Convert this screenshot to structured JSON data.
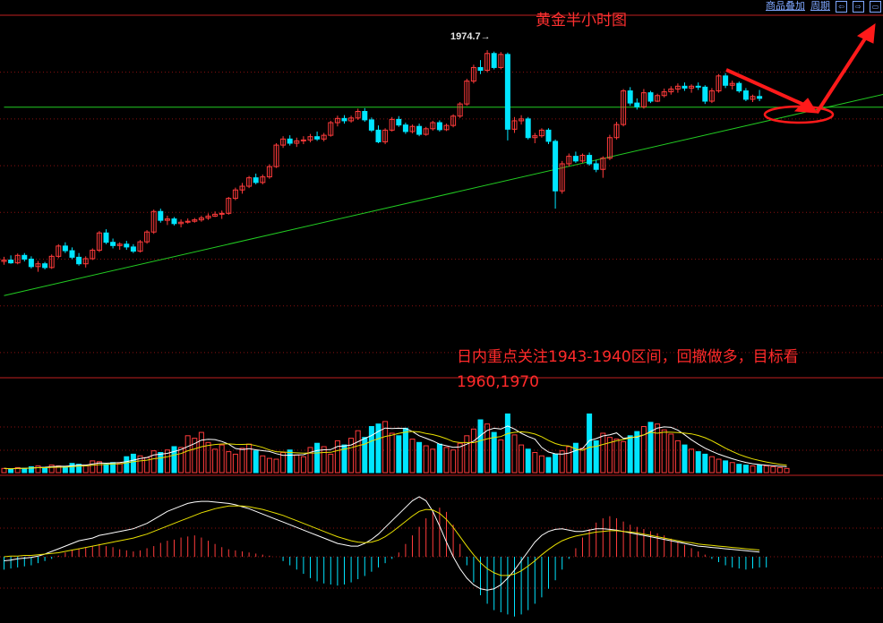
{
  "toolbar": {
    "overlay_label": "商品叠加",
    "period_label": "周期",
    "icons": [
      "arrow-left-icon",
      "arrow-right-icon",
      "layout-icon"
    ]
  },
  "chart_title": "黄金半小时图",
  "annotation": {
    "line1": "日内重点关注1943-1940区间，回撤做多，目标看",
    "line2": "1960,1970"
  },
  "high_label": "1974.7→",
  "colors": {
    "background": "#000000",
    "up": "#ff3b3b",
    "down": "#00e5ff",
    "grid": "#8a1010",
    "trendline": "#22cc22",
    "ma_white": "#ffffff",
    "ma_yellow": "#e8e000",
    "annotation": "#ff2020"
  },
  "chart_data": [
    {
      "type": "candlestick",
      "title": "黄金半小时图",
      "ylim": [
        1905,
        1982
      ],
      "max_label": 1974.7,
      "ohlc": [
        [
          1929.5,
          1930.5,
          1928.8,
          1929.8
        ],
        [
          1929.8,
          1930.8,
          1929.0,
          1929.2
        ],
        [
          1929.2,
          1931.2,
          1928.9,
          1930.8
        ],
        [
          1930.8,
          1931.3,
          1929.5,
          1930.0
        ],
        [
          1930.0,
          1930.6,
          1928.0,
          1928.4
        ],
        [
          1928.4,
          1929.6,
          1927.3,
          1929.0
        ],
        [
          1929.0,
          1929.4,
          1927.8,
          1928.2
        ],
        [
          1928.2,
          1931.0,
          1927.9,
          1930.6
        ],
        [
          1930.6,
          1933.2,
          1930.2,
          1932.8
        ],
        [
          1932.8,
          1933.6,
          1931.3,
          1931.8
        ],
        [
          1931.8,
          1932.5,
          1930.0,
          1930.4
        ],
        [
          1930.4,
          1931.3,
          1928.6,
          1929.0
        ],
        [
          1929.0,
          1930.6,
          1928.2,
          1930.1
        ],
        [
          1930.1,
          1932.3,
          1929.8,
          1931.9
        ],
        [
          1931.9,
          1936.0,
          1931.5,
          1935.6
        ],
        [
          1935.6,
          1936.4,
          1933.2,
          1933.6
        ],
        [
          1933.6,
          1934.4,
          1932.3,
          1932.9
        ],
        [
          1932.9,
          1933.6,
          1932.0,
          1933.2
        ],
        [
          1933.2,
          1933.9,
          1932.0,
          1932.6
        ],
        [
          1932.6,
          1933.2,
          1931.3,
          1931.7
        ],
        [
          1931.7,
          1934.1,
          1931.4,
          1933.7
        ],
        [
          1933.7,
          1936.2,
          1933.3,
          1935.8
        ],
        [
          1935.8,
          1940.6,
          1935.4,
          1940.2
        ],
        [
          1940.2,
          1940.8,
          1937.8,
          1938.3
        ],
        [
          1938.3,
          1939.3,
          1937.3,
          1938.6
        ],
        [
          1938.6,
          1939.0,
          1937.2,
          1937.6
        ],
        [
          1937.6,
          1938.5,
          1936.8,
          1937.9
        ],
        [
          1937.9,
          1938.7,
          1937.6,
          1938.1
        ],
        [
          1938.1,
          1938.8,
          1937.8,
          1938.4
        ],
        [
          1938.4,
          1939.3,
          1938.0,
          1938.8
        ],
        [
          1938.8,
          1939.8,
          1938.4,
          1939.2
        ],
        [
          1939.2,
          1940.2,
          1939.0,
          1939.6
        ],
        [
          1939.6,
          1940.4,
          1938.6,
          1939.8
        ],
        [
          1939.8,
          1943.3,
          1939.5,
          1943.0
        ],
        [
          1943.0,
          1945.3,
          1942.6,
          1944.8
        ],
        [
          1944.8,
          1946.3,
          1944.0,
          1945.6
        ],
        [
          1945.6,
          1947.8,
          1945.2,
          1947.4
        ],
        [
          1947.4,
          1948.3,
          1946.0,
          1946.4
        ],
        [
          1946.4,
          1948.1,
          1946.0,
          1947.6
        ],
        [
          1947.6,
          1950.3,
          1947.2,
          1949.8
        ],
        [
          1949.8,
          1954.8,
          1949.5,
          1954.4
        ],
        [
          1954.4,
          1956.3,
          1953.8,
          1955.7
        ],
        [
          1955.7,
          1956.5,
          1954.3,
          1954.8
        ],
        [
          1954.8,
          1956.0,
          1954.0,
          1955.3
        ],
        [
          1955.3,
          1956.3,
          1954.6,
          1955.5
        ],
        [
          1955.5,
          1956.8,
          1955.0,
          1956.2
        ],
        [
          1956.2,
          1957.3,
          1955.3,
          1955.7
        ],
        [
          1955.7,
          1957.0,
          1955.2,
          1956.5
        ],
        [
          1956.5,
          1959.6,
          1956.2,
          1959.2
        ],
        [
          1959.2,
          1960.7,
          1958.4,
          1960.1
        ],
        [
          1960.1,
          1960.8,
          1959.0,
          1959.6
        ],
        [
          1959.6,
          1960.7,
          1959.2,
          1960.2
        ],
        [
          1960.2,
          1962.2,
          1959.8,
          1961.6
        ],
        [
          1961.6,
          1962.3,
          1959.4,
          1959.8
        ],
        [
          1959.8,
          1960.3,
          1957.2,
          1957.6
        ],
        [
          1957.6,
          1958.6,
          1954.8,
          1955.1
        ],
        [
          1955.1,
          1958.0,
          1954.6,
          1957.6
        ],
        [
          1957.6,
          1960.4,
          1957.3,
          1959.9
        ],
        [
          1959.9,
          1960.6,
          1958.3,
          1958.7
        ],
        [
          1958.7,
          1959.2,
          1956.8,
          1957.3
        ],
        [
          1957.3,
          1958.8,
          1956.9,
          1958.4
        ],
        [
          1958.4,
          1959.0,
          1956.3,
          1956.7
        ],
        [
          1956.7,
          1958.3,
          1956.4,
          1957.9
        ],
        [
          1957.9,
          1959.6,
          1957.5,
          1959.2
        ],
        [
          1959.2,
          1959.7,
          1957.3,
          1957.7
        ],
        [
          1957.7,
          1959.0,
          1957.4,
          1958.6
        ],
        [
          1958.6,
          1961.0,
          1958.2,
          1960.6
        ],
        [
          1960.6,
          1963.6,
          1960.2,
          1963.2
        ],
        [
          1963.2,
          1968.6,
          1962.8,
          1968.1
        ],
        [
          1968.1,
          1971.6,
          1967.6,
          1971.0
        ],
        [
          1971.0,
          1972.6,
          1969.6,
          1970.4
        ],
        [
          1970.4,
          1974.7,
          1970.0,
          1974.0
        ],
        [
          1974.0,
          1974.4,
          1970.6,
          1971.0
        ],
        [
          1971.0,
          1974.3,
          1970.6,
          1973.8
        ],
        [
          1973.8,
          1974.2,
          1955.4,
          1957.8
        ],
        [
          1957.8,
          1960.4,
          1957.0,
          1959.6
        ],
        [
          1959.6,
          1960.8,
          1958.8,
          1960.0
        ],
        [
          1960.0,
          1960.4,
          1955.6,
          1956.0
        ],
        [
          1956.0,
          1957.0,
          1954.8,
          1956.4
        ],
        [
          1956.4,
          1958.0,
          1956.0,
          1957.6
        ],
        [
          1957.6,
          1958.0,
          1954.6,
          1955.2
        ],
        [
          1955.2,
          1955.6,
          1940.8,
          1944.6
        ],
        [
          1944.6,
          1951.0,
          1944.0,
          1950.4
        ],
        [
          1950.4,
          1952.6,
          1949.8,
          1952.0
        ],
        [
          1952.0,
          1953.0,
          1950.6,
          1951.0
        ],
        [
          1951.0,
          1952.6,
          1950.6,
          1952.2
        ],
        [
          1952.2,
          1952.8,
          1950.0,
          1950.4
        ],
        [
          1950.4,
          1951.2,
          1948.6,
          1949.2
        ],
        [
          1949.2,
          1952.0,
          1947.4,
          1951.6
        ],
        [
          1951.6,
          1956.6,
          1951.2,
          1956.0
        ],
        [
          1956.0,
          1959.4,
          1955.6,
          1958.8
        ],
        [
          1958.8,
          1966.4,
          1958.4,
          1966.0
        ],
        [
          1966.0,
          1966.8,
          1962.8,
          1963.4
        ],
        [
          1963.4,
          1964.4,
          1962.0,
          1962.6
        ],
        [
          1962.6,
          1966.4,
          1962.2,
          1965.6
        ],
        [
          1965.6,
          1966.0,
          1963.4,
          1963.8
        ],
        [
          1963.8,
          1965.4,
          1963.6,
          1965.0
        ],
        [
          1965.0,
          1966.5,
          1964.6,
          1965.8
        ],
        [
          1965.8,
          1967.0,
          1965.2,
          1966.4
        ],
        [
          1966.4,
          1967.6,
          1965.6,
          1967.0
        ],
        [
          1967.0,
          1967.8,
          1966.0,
          1966.6
        ],
        [
          1966.6,
          1967.4,
          1965.6,
          1967.0
        ],
        [
          1967.0,
          1967.8,
          1966.2,
          1966.8
        ],
        [
          1966.8,
          1967.2,
          1963.2,
          1963.8
        ],
        [
          1963.8,
          1966.6,
          1963.4,
          1966.0
        ],
        [
          1966.0,
          1969.6,
          1965.6,
          1969.2
        ],
        [
          1969.2,
          1969.8,
          1966.6,
          1967.2
        ],
        [
          1967.2,
          1968.2,
          1966.3,
          1967.6
        ],
        [
          1967.6,
          1968.0,
          1965.6,
          1966.0
        ],
        [
          1966.0,
          1966.6,
          1963.8,
          1964.2
        ],
        [
          1964.2,
          1965.2,
          1963.6,
          1964.8
        ],
        [
          1964.8,
          1966.2,
          1963.8,
          1964.4
        ]
      ],
      "trendlines": [
        {
          "from": [
            0,
            1922.2
          ],
          "to": [
            135,
            1967.2
          ]
        },
        {
          "from": [
            0,
            1962.5
          ],
          "to": [
            135,
            1962.5
          ]
        }
      ]
    },
    {
      "type": "bar",
      "subtype": "volume",
      "volume": [
        5,
        4,
        6,
        5,
        7,
        8,
        6,
        9,
        8,
        7,
        11,
        10,
        9,
        14,
        13,
        10,
        12,
        11,
        19,
        22,
        20,
        18,
        26,
        24,
        27,
        31,
        30,
        44,
        41,
        48,
        36,
        28,
        33,
        25,
        22,
        29,
        34,
        26,
        20,
        17,
        16,
        24,
        27,
        21,
        19,
        30,
        35,
        31,
        22,
        38,
        33,
        41,
        50,
        42,
        55,
        58,
        61,
        47,
        44,
        53,
        40,
        36,
        32,
        28,
        34,
        30,
        27,
        35,
        44,
        52,
        63,
        58,
        48,
        39,
        70,
        45,
        33,
        28,
        24,
        20,
        18,
        22,
        26,
        31,
        35,
        29,
        70,
        38,
        47,
        42,
        40,
        37,
        44,
        49,
        55,
        60,
        58,
        51,
        46,
        38,
        33,
        28,
        25,
        22,
        19,
        16,
        14,
        12,
        10,
        9,
        8,
        9,
        8,
        7,
        6,
        5
      ],
      "vol_max": 110
    },
    {
      "type": "bar",
      "subtype": "macd",
      "macd_hist": [
        -1.2,
        -1.1,
        -1.0,
        -0.9,
        -0.8,
        -0.6,
        -0.4,
        -0.2,
        0.1,
        0.4,
        0.6,
        0.8,
        0.9,
        1.0,
        1.2,
        1.0,
        0.9,
        0.7,
        0.6,
        0.5,
        0.6,
        0.8,
        1.0,
        1.3,
        1.5,
        1.6,
        1.8,
        1.9,
        2.0,
        1.8,
        1.5,
        1.2,
        0.9,
        0.7,
        0.6,
        0.5,
        0.4,
        0.3,
        0.2,
        0.1,
        0.0,
        -0.4,
        -0.8,
        -1.2,
        -1.6,
        -2.0,
        -2.3,
        -2.5,
        -2.6,
        -2.7,
        -2.6,
        -2.4,
        -2.1,
        -1.8,
        -1.4,
        -1.0,
        -0.6,
        -0.2,
        0.4,
        1.2,
        2.0,
        2.8,
        3.6,
        4.2,
        4.6,
        4.2,
        3.0,
        1.2,
        -0.8,
        -2.4,
        -3.6,
        -4.4,
        -5.0,
        -5.2,
        -5.4,
        -5.6,
        -5.4,
        -5.0,
        -4.4,
        -3.8,
        -3.0,
        -2.2,
        -1.2,
        -0.2,
        0.8,
        1.8,
        2.6,
        3.2,
        3.6,
        3.8,
        3.6,
        3.3,
        3.0,
        2.8,
        2.6,
        2.4,
        2.2,
        2.0,
        1.7,
        1.4,
        1.1,
        0.8,
        0.5,
        0.2,
        -0.2,
        -0.5,
        -0.8,
        -1.0,
        -1.1,
        -1.2,
        -1.1,
        -1.0,
        -1.0
      ],
      "dif_line": [
        -0.6,
        -0.5,
        -0.3,
        -0.2,
        -0.1,
        0.1,
        0.4,
        0.8,
        1.2,
        1.6,
        2.0,
        2.4,
        2.6,
        2.8,
        3.2,
        3.4,
        3.6,
        3.8,
        4.0,
        4.2,
        4.6,
        5.0,
        5.6,
        6.2,
        6.8,
        7.2,
        7.6,
        8.0,
        8.2,
        8.3,
        8.3,
        8.2,
        8.1,
        8.0,
        7.8,
        7.5,
        7.2,
        6.8,
        6.4,
        6.0,
        5.6,
        5.2,
        4.8,
        4.4,
        4.0,
        3.6,
        3.2,
        2.8,
        2.4,
        2.0,
        1.8,
        1.6,
        1.6,
        2.0,
        2.6,
        3.4,
        4.4,
        5.4,
        6.4,
        7.4,
        8.4,
        9.0,
        8.4,
        6.8,
        4.6,
        2.2,
        0.0,
        -1.8,
        -3.2,
        -4.2,
        -4.8,
        -5.0,
        -4.8,
        -4.2,
        -3.2,
        -2.0,
        -0.6,
        0.8,
        2.2,
        3.2,
        3.8,
        4.1,
        4.2,
        4.0,
        3.8,
        3.8,
        4.0,
        4.2,
        4.2,
        4.1,
        4.0,
        3.8,
        3.6,
        3.4,
        3.2,
        3.0,
        2.8,
        2.6,
        2.4,
        2.2,
        2.0,
        1.8,
        1.6,
        1.5,
        1.4,
        1.3,
        1.2,
        1.1,
        1.0,
        0.9,
        0.8,
        0.7
      ],
      "dea_line": [
        0.0,
        0.1,
        0.1,
        0.2,
        0.2,
        0.3,
        0.4,
        0.5,
        0.6,
        0.8,
        1.0,
        1.2,
        1.4,
        1.6,
        1.8,
        2.0,
        2.2,
        2.4,
        2.6,
        2.8,
        3.1,
        3.4,
        3.8,
        4.2,
        4.6,
        5.0,
        5.4,
        5.8,
        6.2,
        6.6,
        6.9,
        7.2,
        7.4,
        7.6,
        7.6,
        7.6,
        7.5,
        7.3,
        7.1,
        6.8,
        6.5,
        6.2,
        5.8,
        5.4,
        5.0,
        4.6,
        4.2,
        3.8,
        3.4,
        3.0,
        2.7,
        2.4,
        2.2,
        2.1,
        2.2,
        2.5,
        3.0,
        3.7,
        4.5,
        5.3,
        6.1,
        6.8,
        7.1,
        7.0,
        6.5,
        5.6,
        4.4,
        3.0,
        1.6,
        0.3,
        -0.9,
        -1.8,
        -2.4,
        -2.8,
        -2.8,
        -2.6,
        -2.1,
        -1.4,
        -0.6,
        0.3,
        1.1,
        1.8,
        2.4,
        2.8,
        3.1,
        3.3,
        3.5,
        3.7,
        3.8,
        3.9,
        3.9,
        3.8,
        3.7,
        3.6,
        3.4,
        3.2,
        3.0,
        2.8,
        2.6,
        2.4,
        2.2,
        2.1,
        1.9,
        1.8,
        1.7,
        1.6,
        1.5,
        1.4,
        1.3,
        1.2,
        1.1,
        1.0
      ],
      "macd_range": [
        -7,
        11
      ]
    }
  ]
}
